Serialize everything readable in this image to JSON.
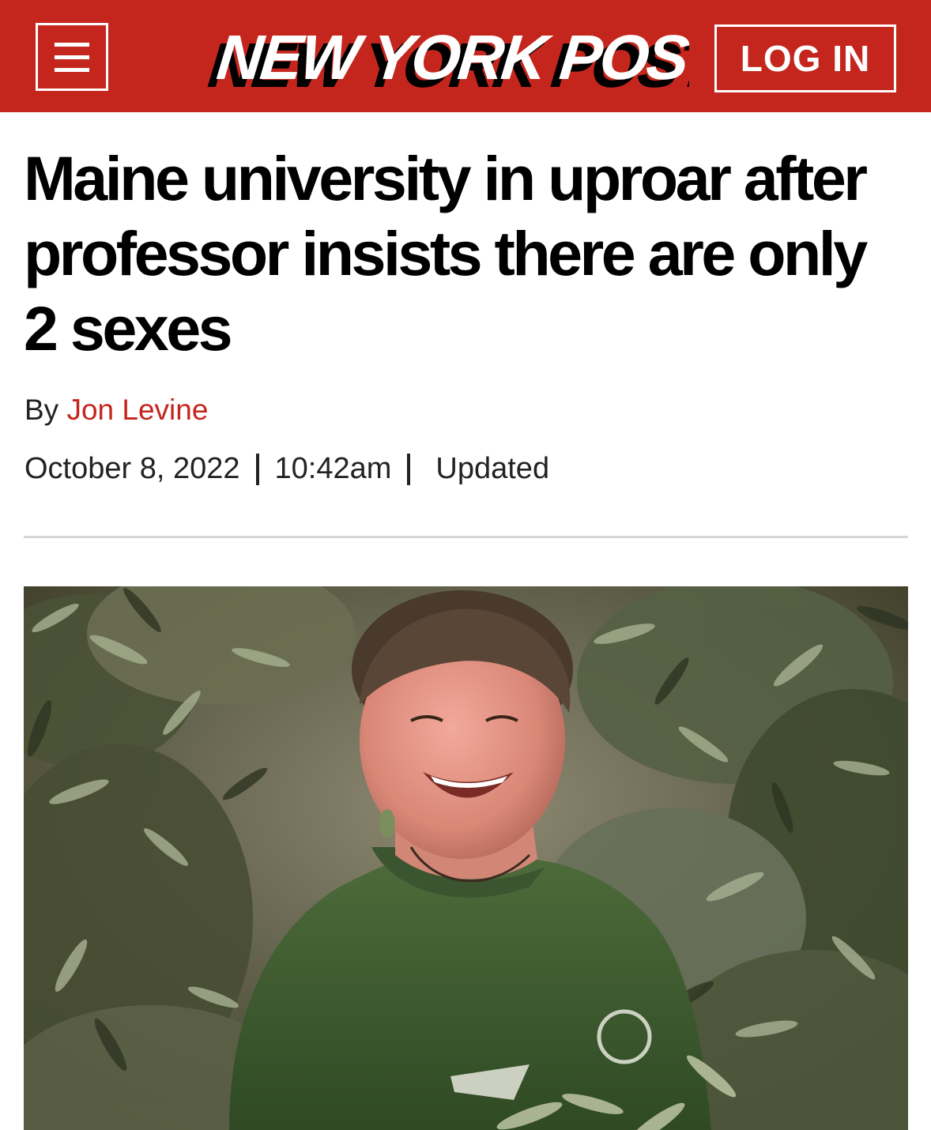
{
  "header": {
    "logo_text": "NEW YORK POST",
    "login_label": "LOG IN",
    "brand_color": "#c4261d",
    "menu_icon": "hamburger-menu-icon"
  },
  "article": {
    "headline": "Maine university in uproar after professor insists there are only 2 sexes",
    "byline_prefix": "By",
    "author": "Jon Levine",
    "date": "October 8, 2022",
    "time": "10:42am",
    "updated_label": "Updated"
  }
}
